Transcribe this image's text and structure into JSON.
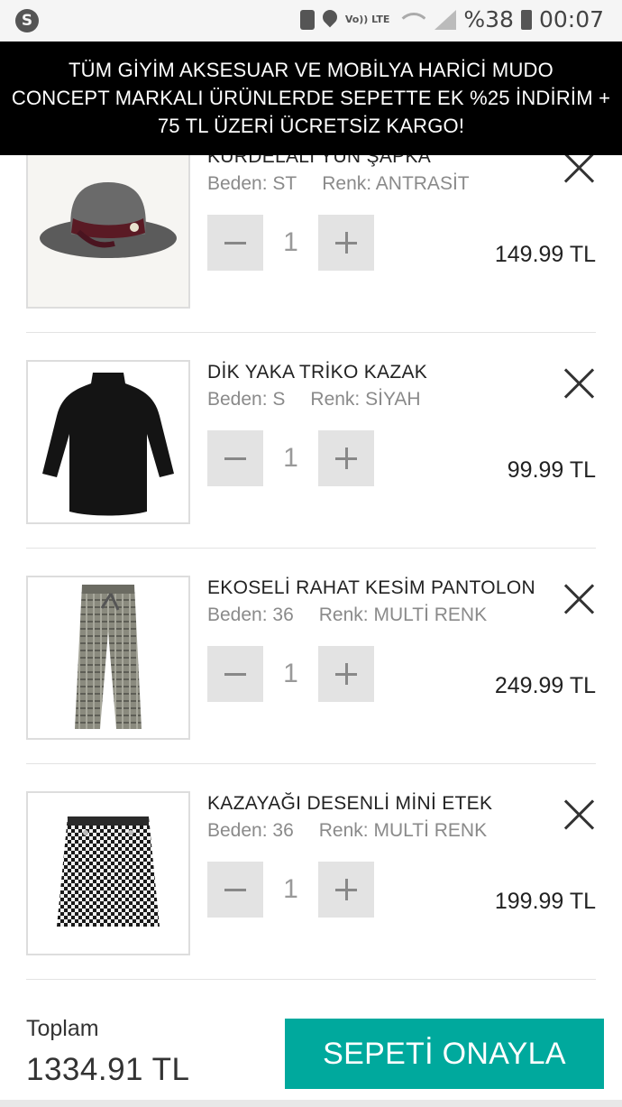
{
  "status_bar": {
    "battery_text": "%38",
    "time": "00:07",
    "volte_label": "Vo)) LTE",
    "icons": [
      "shazam-icon",
      "lock-icon",
      "location-icon",
      "volte-icon",
      "wifi-icon",
      "signal-icon",
      "battery-icon"
    ]
  },
  "promo": {
    "line1": "TÜM GİYİM AKSESUAR VE MOBİLYA HARİCİ MUDO",
    "line2": "CONCEPT MARKALI ÜRÜNLERDE SEPETTE EK %25 İNDİRİM +",
    "line3": "75 TL ÜZERİ ÜCRETSİZ KARGO!"
  },
  "items": [
    {
      "name": "KURDELALI YÜN ŞAPKA",
      "size": "Beden: ST",
      "color": "Renk: ANTRASİT",
      "qty": "1",
      "price": "149.99 TL",
      "image": "hat"
    },
    {
      "name": "DİK YAKA TRİKO KAZAK",
      "size": "Beden: S",
      "color": "Renk: SİYAH",
      "qty": "1",
      "price": "99.99 TL",
      "image": "sweater"
    },
    {
      "name": "EKOSELİ RAHAT KESİM PANTOLON",
      "size": "Beden: 36",
      "color": "Renk: MULTİ RENK",
      "qty": "1",
      "price": "249.99 TL",
      "image": "trousers"
    },
    {
      "name": "KAZAYAĞI DESENLİ MİNİ ETEK",
      "size": "Beden: 36",
      "color": "Renk: MULTİ RENK",
      "qty": "1",
      "price": "199.99 TL",
      "image": "skirt"
    }
  ],
  "footer": {
    "total_label": "Toplam",
    "total_value": "1334.91 TL",
    "confirm_label": "SEPETİ ONAYLA"
  },
  "colors": {
    "accent": "#00a99d",
    "banner": "#000000",
    "qty_button": "#e3e3e3"
  }
}
